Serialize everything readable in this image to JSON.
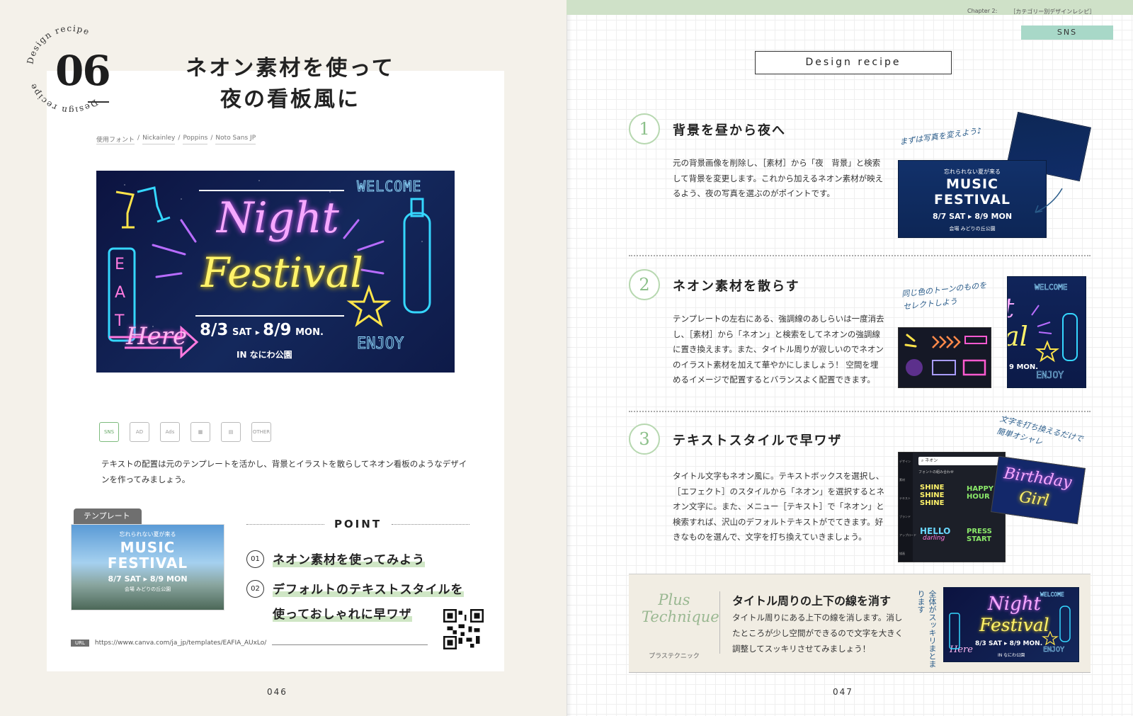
{
  "left": {
    "seal_text": "Design recipe",
    "number": "06",
    "title_line1": "ネオン素材を使って",
    "title_line2": "夜の看板風に",
    "fonts_label": "使用フォント",
    "fonts": [
      "Nickainley",
      "Poppins",
      "Noto Sans JP"
    ],
    "hero": {
      "welcome": "WELCOME",
      "night": "Night",
      "festival": "Festival",
      "eat": [
        "E",
        "A",
        "T"
      ],
      "here": "Here",
      "date1": "8/3",
      "day1": "SAT",
      "date2": "8/9",
      "day2": "MON.",
      "venue": "IN なにわ公園",
      "enjoy": "ENJOY"
    },
    "category_icons": [
      "SNS",
      "AD",
      "Ads",
      "",
      "",
      "OTHER"
    ],
    "lead_text": "テキストの配置は元のテンプレートを活かし、背景とイラストを散らしてネオン看板のようなデザインを作ってみましょう。",
    "template_tab": "テンプレート",
    "template_image": {
      "line1": "忘れられない夏が来る",
      "line2": "MUSIC",
      "line3": "FESTIVAL",
      "line4": "8/7 SAT ▸ 8/9 MON",
      "line5": "会場 みどりの丘公園"
    },
    "point_label": "POINT",
    "points": [
      {
        "num": "01",
        "line1": "ネオン素材を使ってみよう",
        "line2": ""
      },
      {
        "num": "02",
        "line1": "デフォルトのテキストスタイルを",
        "line2": "使っておしゃれに早ワザ"
      }
    ],
    "url_label": "URL",
    "url": "https://www.canva.com/ja_jp/templates/EAFIA_AUxLo/",
    "page_number": "046"
  },
  "right": {
    "chapter": "Chapter 2:",
    "chapter_title": "［カテゴリー別デザインレシピ］",
    "category": "SNS",
    "recipe_box": "Design recipe",
    "steps": [
      {
        "num": "1",
        "heading": "背景を昼から夜へ",
        "body": "元の背景画像を削除し、［素材］から「夜　背景」と検索して背景を変更します。これから加えるネオン素材が映えるよう、夜の写真を選ぶのがポイントです。",
        "note": "まずは写真を変えよう♪"
      },
      {
        "num": "2",
        "heading": "ネオン素材を散らす",
        "body": "テンプレートの左右にある、強調線のあしらいは一度消去し、［素材］から「ネオン」と検索をしてネオンの強調線に置き換えます。また、タイトル周りが寂しいのでネオンのイラスト素材を加えて華やかにしましょう！ 空間を埋めるイメージで配置するとバランスよく配置できます。",
        "note": "同じ色のトーンのものをセレクトしよう"
      },
      {
        "num": "3",
        "heading": "テキストスタイルで早ワザ",
        "body": "タイトル文字もネオン風に。テキストボックスを選択し、［エフェクト］のスタイルから「ネオン」を選択するとネオン文字に。また、メニュー［テキスト］で「ネオン」と検索すれば、沢山のデフォルトテキストがでてきます。好きなものを選んで、文字を打ち換えていきましょう。",
        "note": "文字を打ち換えるだけで簡単オシャレ"
      }
    ],
    "step1_image": {
      "line1": "忘れられない夏が来る",
      "line2": "MUSIC",
      "line3": "FESTIVAL",
      "line4": "8/7 SAT ▸ 8/9 MON",
      "line5": "会場 みどりの丘公園"
    },
    "step2_image": {
      "welcome": "WELCOME",
      "mon": "9 MON.",
      "enjoy": "ENJOY"
    },
    "step3_panel": {
      "search": "ネオン",
      "section": "フォントの組み合わせ",
      "shine": "SHINE",
      "happy": "HAPPY HOUR",
      "hello": "HELLO",
      "darling": "darling",
      "press": "PRESS START",
      "side": [
        "デザイン",
        "素材",
        "テキスト",
        "ブランド",
        "アップロード",
        "描画"
      ]
    },
    "step3_badge": {
      "line1": "Birthday",
      "line2": "Girl"
    },
    "plus": {
      "script_line1": "Plus",
      "script_line2": "Technique",
      "sub": "プラステクニック",
      "heading": "タイトル周りの上下の線を消す",
      "body": "タイトル周りにある上下の線を消します。消したところが少し空間ができるので文字を大きく調整してスッキリさせてみましょう！",
      "note": "全体がスッキリまとまります",
      "image": {
        "welcome": "WELCOME",
        "night": "Night",
        "festival": "Festival",
        "date": "8/3 SAT ▸ 8/9 MON.",
        "venue": "IN なにわ公園",
        "here": "Here",
        "enjoy": "ENJOY"
      }
    },
    "page_number": "047"
  }
}
